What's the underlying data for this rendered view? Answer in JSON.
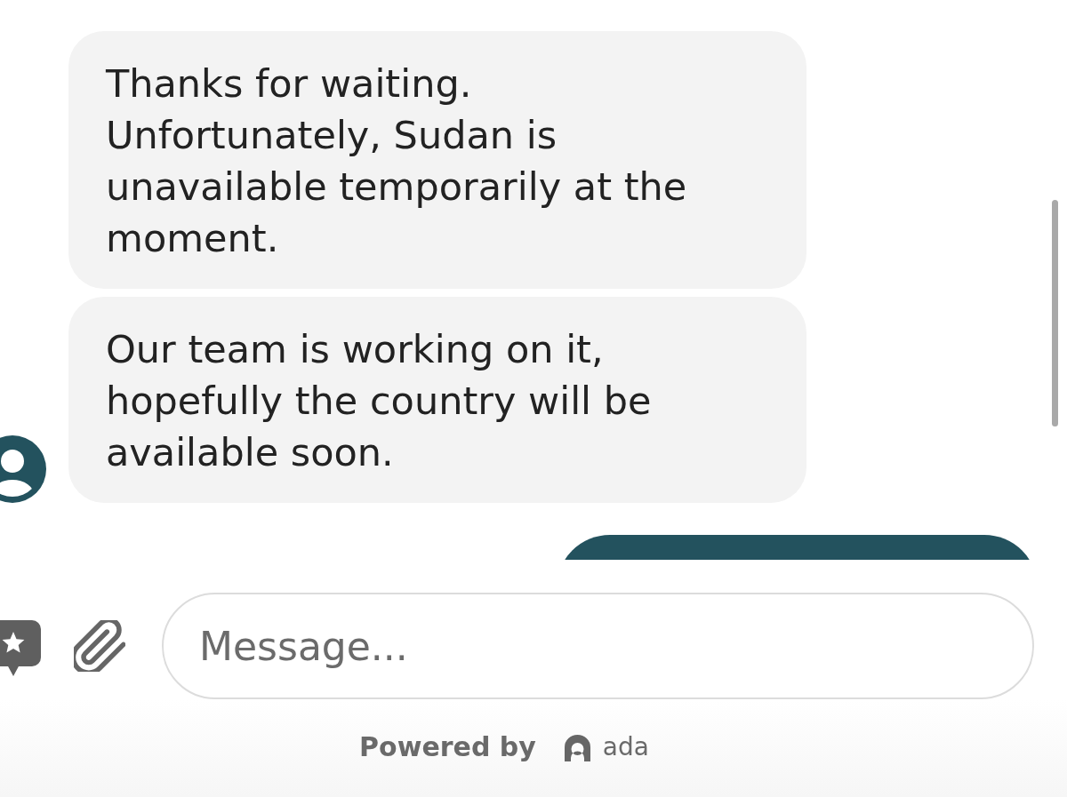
{
  "messages": [
    {
      "kind": "incoming",
      "text": "Thanks for waiting. Unfortunately, Sudan is unavailable temporarily at the moment.",
      "avatar": false
    },
    {
      "kind": "incoming",
      "text": "Our team is working on it, hopefully the country will be available soon.",
      "avatar": true
    },
    {
      "kind": "outgoing"
    }
  ],
  "composer": {
    "placeholder": "Message..."
  },
  "footer": {
    "label": "Powered by",
    "brand": "ada"
  }
}
